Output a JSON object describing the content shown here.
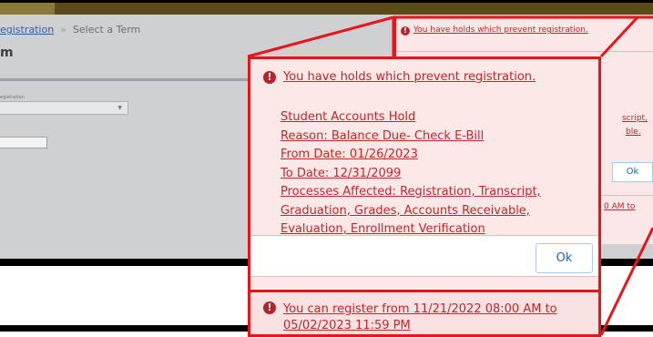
{
  "breadcrumb": {
    "link": "egistration",
    "separator": "»",
    "current": "Select a Term"
  },
  "page_title": "m",
  "term_label": "egistration",
  "right_panel": {
    "hold_message": "You have holds which prevent registration.",
    "fragment_1": "script,",
    "fragment_2": "ble.",
    "ok_label": "Ok",
    "fragment_3": "0 AM to"
  },
  "dialog": {
    "hold_message": "You have holds which prevent registration.",
    "hold_details": [
      "Student Accounts Hold",
      "Reason: Balance Due- Check E-Bill",
      "From Date: 01/26/2023",
      "To Date: 12/31/2099",
      "Processes Affected: Registration, Transcript,",
      "Graduation, Grades, Accounts Receivable,",
      "Evaluation, Enrollment Verification"
    ],
    "ok_label": "Ok",
    "register_line1": "You can register from 11/21/2022 08:00 AM to",
    "register_line2": "05/02/2023 11:59 PM"
  },
  "icons": {
    "alert": "exclamation-circle-icon",
    "alert_glyph": "!"
  },
  "colors": {
    "alert_red": "#c3242b",
    "frame_red": "#e8141a",
    "ok_blue": "#2563a8"
  }
}
